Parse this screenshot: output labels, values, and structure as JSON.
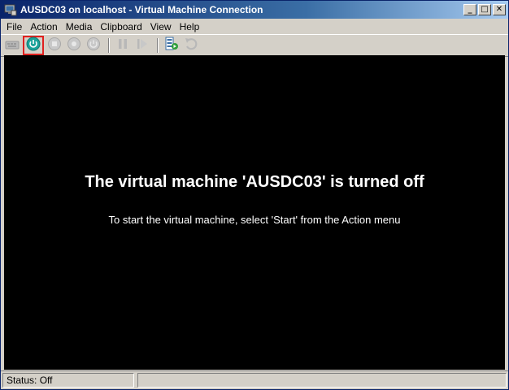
{
  "window": {
    "title": "AUSDC03 on localhost - Virtual Machine Connection",
    "buttons": {
      "minimize": "_",
      "maximize": "□",
      "close": "✕"
    }
  },
  "menu": [
    "File",
    "Action",
    "Media",
    "Clipboard",
    "View",
    "Help"
  ],
  "toolbar": {
    "icons": [
      "ctrl-alt-del-icon",
      "start-icon",
      "turn-off-icon",
      "shutdown-icon",
      "save-icon",
      "pause-icon",
      "reset-icon",
      "snapshot-icon",
      "revert-icon"
    ],
    "highlight_color": "#e0201e",
    "start_color": "#1aa39a"
  },
  "screen": {
    "heading": "The virtual machine 'AUSDC03' is turned off",
    "subtext": "To start the virtual machine, select 'Start' from the Action menu"
  },
  "status": {
    "text": "Status: Off"
  }
}
